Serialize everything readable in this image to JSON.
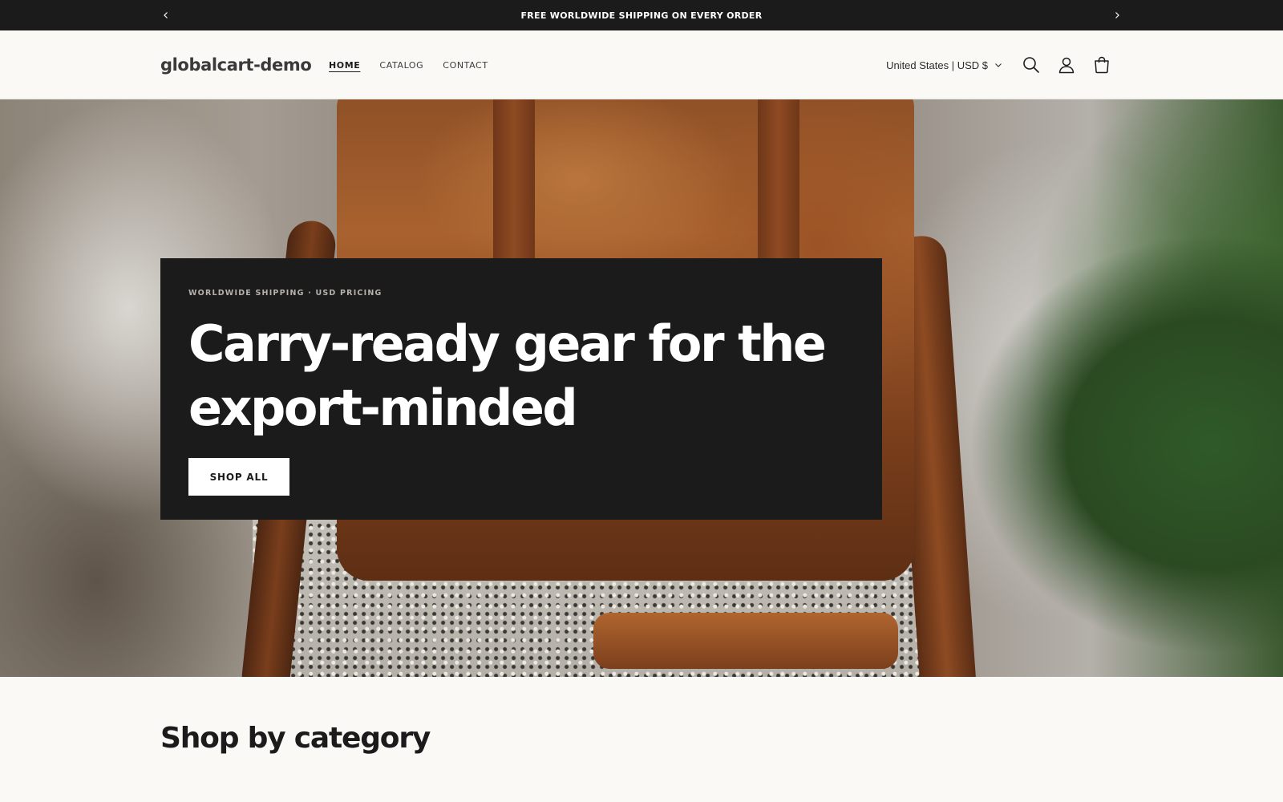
{
  "announcement": {
    "text": "FREE WORLDWIDE SHIPPING ON EVERY ORDER",
    "prev_icon": "chevron-left-icon",
    "next_icon": "chevron-right-icon"
  },
  "header": {
    "logo": "globalcart-demo",
    "nav": [
      {
        "label": "HOME",
        "active": true
      },
      {
        "label": "CATALOG",
        "active": false
      },
      {
        "label": "CONTACT",
        "active": false
      }
    ],
    "locale": "United States | USD $",
    "icons": [
      "search-icon",
      "account-icon",
      "cart-icon"
    ]
  },
  "hero": {
    "eyebrow": "WORLDWIDE SHIPPING · USD PRICING",
    "title": "Carry-ready gear for the export-minded",
    "button": "SHOP ALL"
  },
  "section": {
    "title": "Shop by category"
  },
  "colors": {
    "dark": "#1c1b1b",
    "background": "#faf9f6",
    "white": "#ffffff"
  }
}
